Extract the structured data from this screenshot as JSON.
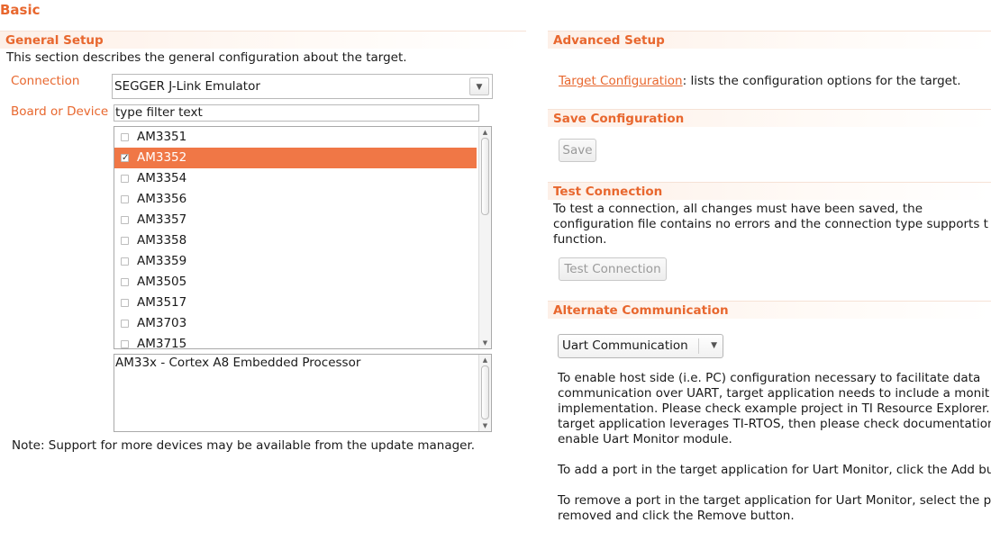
{
  "page": {
    "title": "Basic"
  },
  "general_setup": {
    "header": "General Setup",
    "description": "This section describes the general configuration about the target.",
    "connection_label": "Connection",
    "connection_value": "SEGGER J-Link Emulator",
    "board_label": "Board or Device",
    "filter_placeholder": "type filter text",
    "devices": [
      {
        "label": "AM3351",
        "checked": false,
        "selected": false
      },
      {
        "label": "AM3352",
        "checked": true,
        "selected": true
      },
      {
        "label": "AM3354",
        "checked": false,
        "selected": false
      },
      {
        "label": "AM3356",
        "checked": false,
        "selected": false
      },
      {
        "label": "AM3357",
        "checked": false,
        "selected": false
      },
      {
        "label": "AM3358",
        "checked": false,
        "selected": false
      },
      {
        "label": "AM3359",
        "checked": false,
        "selected": false
      },
      {
        "label": "AM3505",
        "checked": false,
        "selected": false
      },
      {
        "label": "AM3517",
        "checked": false,
        "selected": false
      },
      {
        "label": "AM3703",
        "checked": false,
        "selected": false
      },
      {
        "label": "AM3715",
        "checked": false,
        "selected": false
      }
    ],
    "device_description": "AM33x - Cortex A8 Embedded Processor",
    "note": "Note: Support for more devices may be available from the update manager."
  },
  "advanced_setup": {
    "header": "Advanced Setup",
    "link_text": "Target Configuration",
    "link_suffix": ": lists the configuration options for the target."
  },
  "save_configuration": {
    "header": "Save Configuration",
    "button_label": "Save"
  },
  "test_connection": {
    "header": "Test Connection",
    "lines": [
      "To test a connection, all changes must have been saved, the",
      "configuration file contains no errors and the connection type supports t",
      "function."
    ],
    "button_label": "Test Connection"
  },
  "alternate_communication": {
    "header": "Alternate Communication",
    "combo_value": "Uart Communication",
    "paragraph1": [
      "To enable host side (i.e. PC) configuration necessary to facilitate data",
      "communication over UART, target application needs to include a monit",
      "implementation. Please check example project in TI Resource Explorer.",
      "target application leverages TI-RTOS, then please check documentation",
      "enable Uart Monitor module."
    ],
    "paragraph2": [
      "To add a port in the target application for Uart Monitor, click the Add bu"
    ],
    "paragraph3": [
      "To remove a port in the target application for Uart Monitor, select the p",
      "removed and click the Remove button."
    ]
  },
  "colors": {
    "accent": "#e8672e",
    "selection": "#f07746"
  }
}
